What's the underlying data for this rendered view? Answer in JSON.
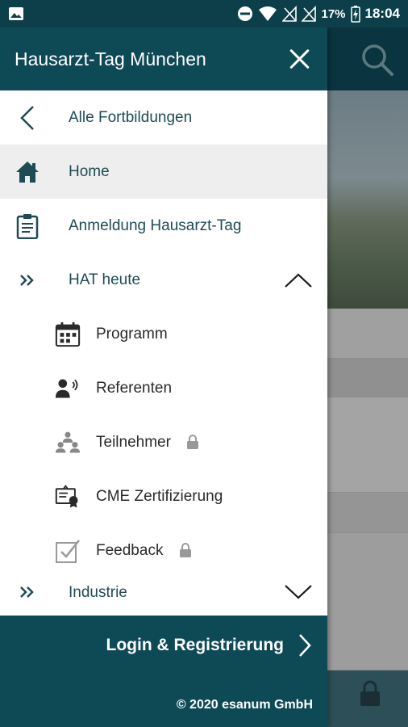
{
  "status_bar": {
    "battery_text": "17%",
    "time": "18:04",
    "icons": [
      "image-icon",
      "do-not-disturb-icon",
      "wifi-icon",
      "no-signal-icon",
      "no-signal-icon",
      "battery-charging-icon"
    ]
  },
  "drawer": {
    "title": "Hausarzt-Tag München",
    "back_label": "Alle Fortbildungen",
    "items": [
      {
        "label": "Home",
        "icon": "home-icon",
        "active": true
      },
      {
        "label": "Anmeldung Hausarzt-Tag",
        "icon": "clipboard-icon"
      },
      {
        "label": "HAT heute",
        "icon": "double-chevron-icon",
        "expanded": true
      }
    ],
    "subitems": [
      {
        "label": "Programm",
        "icon": "calendar-icon"
      },
      {
        "label": "Referenten",
        "icon": "speaker-icon"
      },
      {
        "label": "Teilnehmer",
        "icon": "participants-icon",
        "locked": true
      },
      {
        "label": "CME Zertifizierung",
        "icon": "certificate-icon"
      },
      {
        "label": "Feedback",
        "icon": "checkbox-icon",
        "locked": true
      }
    ],
    "industry_label": "Industrie",
    "login_label": "Login & Registrierung",
    "copyright": "© 2020 esanum GmbH"
  },
  "colors": {
    "header_teal": "#0e4a56",
    "text_teal": "#1f4b55",
    "active_bg": "#eeeeee"
  }
}
